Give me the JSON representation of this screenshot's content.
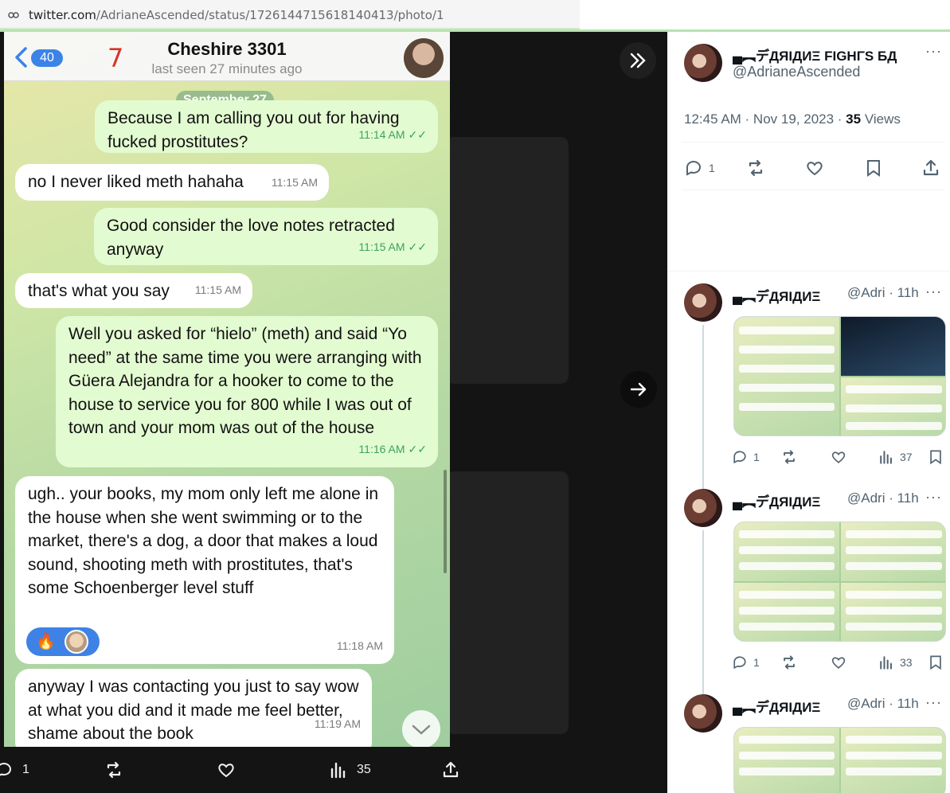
{
  "browser": {
    "url_host": "twitter.com",
    "url_path": "/AdrianeAscended/status/1726144715618140413/photo/1"
  },
  "chat": {
    "back_count": "40",
    "red_number": "7",
    "contact_name": "Cheshire 3301",
    "last_seen": "last seen 27 minutes ago",
    "date_separator": "September 27",
    "messages": [
      {
        "dir": "out",
        "text": "Because I am calling you out for having fucked prostitutes?",
        "time": "11:14 AM"
      },
      {
        "dir": "in",
        "text": "no I never liked meth hahaha",
        "time": "11:15 AM"
      },
      {
        "dir": "out",
        "text": "Good consider the love notes retracted anyway",
        "time": "11:15 AM"
      },
      {
        "dir": "in",
        "text": "that's what you say",
        "time": "11:15 AM"
      },
      {
        "dir": "out",
        "text": "Well you asked for “hielo” (meth) and said “Yo need” at the same time you were arranging with Güera Alejandra for a hooker to come to the house to service you for 800 while I was out of town and your mom was out of the house",
        "time": "11:16 AM"
      },
      {
        "dir": "in",
        "text": "ugh.. your books, my mom only left me alone in the house when she went swimming or to the market, there's a dog, a door that makes a loud sound, shooting meth with prostitutes, that's some Schoenberger level stuff",
        "time": "11:18 AM"
      },
      {
        "dir": "in",
        "text": "anyway I was contacting you just to say wow at what you did and it made me feel better, shame about the book",
        "time": "11:19 AM"
      }
    ],
    "reaction_emoji": "🔥"
  },
  "bottom_bar": {
    "reply_count": "1",
    "view_count": "35"
  },
  "tweet": {
    "display_name": "▄︻デДЯІДИΞ FIGHΓЅ БД",
    "handle": "@AdrianeAscended",
    "timestamp": "12:45 AM · Nov 19, 2023 · ",
    "views_count": "35",
    "views_label": " Views",
    "reply_count": "1"
  },
  "replies": [
    {
      "name": "▄︻デДЯІДИΞ",
      "handle": "@Adri · 11h",
      "reply_count": "1",
      "views": "37"
    },
    {
      "name": "▄︻デДЯІДИΞ",
      "handle": "@Adri · 11h",
      "reply_count": "1",
      "views": "33"
    },
    {
      "name": "▄︻デДЯІДИΞ",
      "handle": "@Adri · 11h"
    }
  ],
  "colors": {
    "telegram_blue": "#3c83e8",
    "outgoing_bubble": "#e3fbd1",
    "check_green": "#3aa45a"
  }
}
